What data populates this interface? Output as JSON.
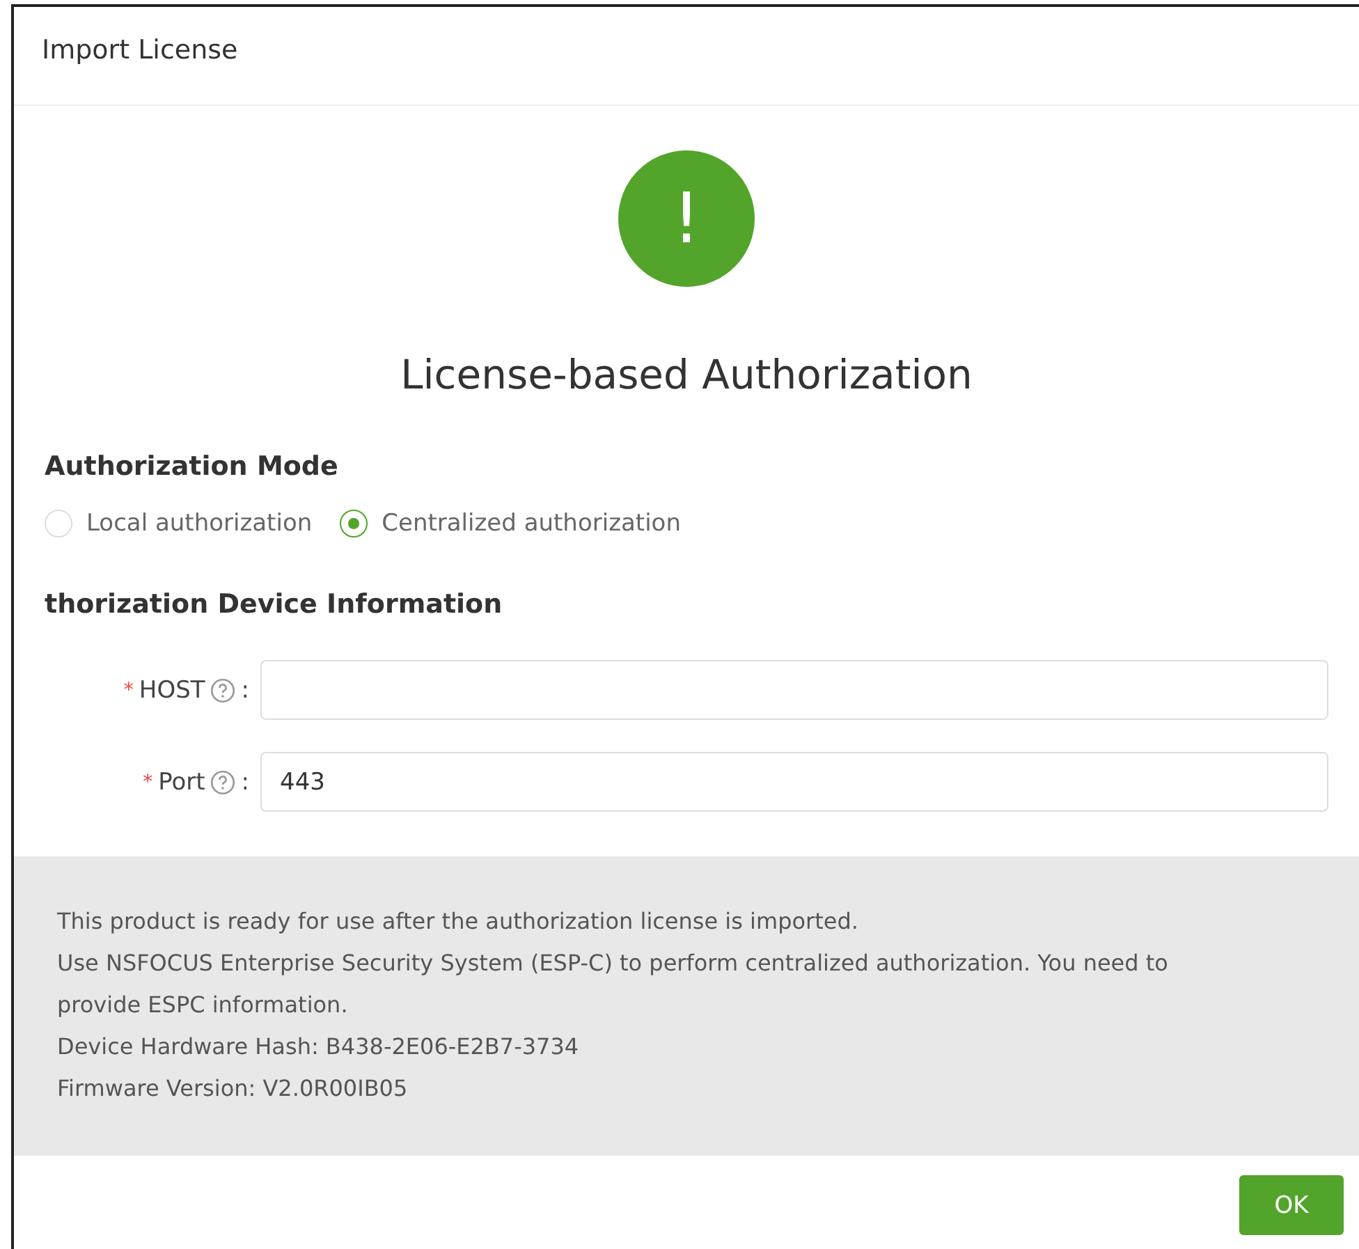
{
  "dialog": {
    "title": "Import License"
  },
  "status": {
    "kind": "warning",
    "icon_text": "!",
    "heading": "License-based Authorization"
  },
  "mode": {
    "heading": "Authorization Mode",
    "options": [
      {
        "label": "Local authorization",
        "selected": false
      },
      {
        "label": "Centralized authorization",
        "selected": true
      }
    ]
  },
  "device_info": {
    "heading": "thorization Device Information",
    "fields": [
      {
        "label": "HOST",
        "required": true,
        "required_mark": "*",
        "colon": ":"
      },
      {
        "label": "Port",
        "required": true,
        "required_mark": "*",
        "colon": ":",
        "value": "443"
      }
    ]
  },
  "info_lines": [
    "This product is ready for use after the authorization license is imported.",
    "Use NSFOCUS Enterprise Security System (ESP-C) to perform centralized authorization. You need to provide ESPC information.",
    "Device Hardware Hash: B438-2E06-E2B7-3734",
    "Firmware Version: V2.0R00IB05"
  ],
  "buttons": [
    "OK"
  ]
}
